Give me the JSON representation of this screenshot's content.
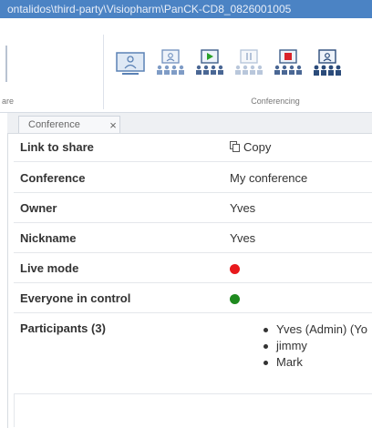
{
  "window": {
    "title": "ontalidos\\third-party\\Visiopharm\\PanCK-CD8_0826001005"
  },
  "ribbon": {
    "left_group_label": "are",
    "group_label": "Conferencing",
    "buttons": [
      {
        "icon": "presentation-screen-icon"
      },
      {
        "icon": "presenter-audience-icon"
      },
      {
        "icon": "play-audience-icon"
      },
      {
        "icon": "pause-audience-icon"
      },
      {
        "icon": "stop-audience-icon"
      },
      {
        "icon": "participants-group-icon"
      }
    ]
  },
  "tab": {
    "label": "Conference",
    "close": "×"
  },
  "rows": [
    {
      "key": "Link to share",
      "value": "Copy",
      "icon": "copy-icon"
    },
    {
      "key": "Conference",
      "value": "My conference"
    },
    {
      "key": "Owner",
      "value": "Yves"
    },
    {
      "key": "Nickname",
      "value": "Yves"
    },
    {
      "key": "Live mode",
      "status_color": "#e8191c"
    },
    {
      "key": "Everyone in control",
      "status_color": "#1f8a1f"
    }
  ],
  "participants": {
    "label": "Participants (3)",
    "list": [
      "Yves (Admin) (Yo",
      "jimmy",
      "Mark"
    ]
  }
}
